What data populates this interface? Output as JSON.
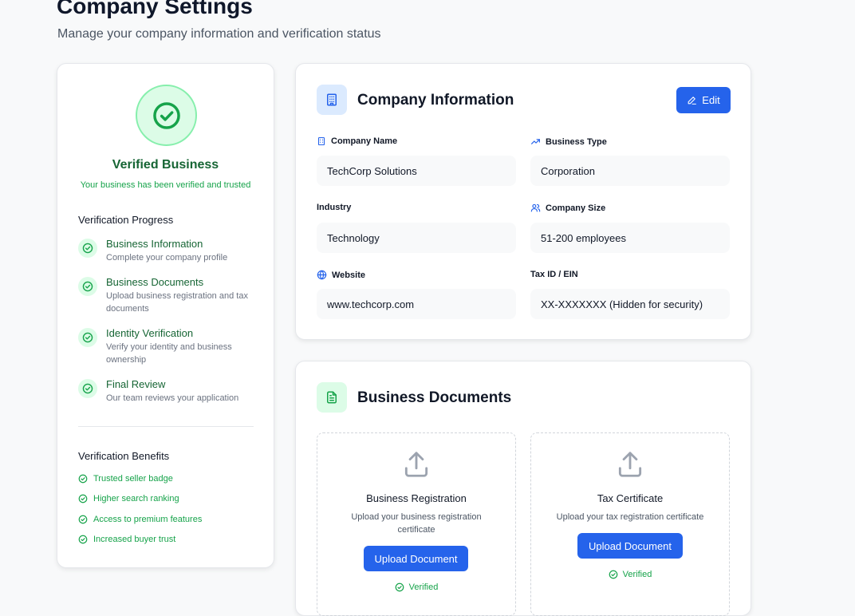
{
  "header": {
    "title": "Company Settings",
    "subtitle": "Manage your company information and verification status"
  },
  "verification": {
    "status_title": "Verified Business",
    "status_subtitle": "Your business has been verified and trusted",
    "progress_heading": "Verification Progress",
    "steps": [
      {
        "title": "Business Information",
        "description": "Complete your company profile"
      },
      {
        "title": "Business Documents",
        "description": "Upload business registration and tax documents"
      },
      {
        "title": "Identity Verification",
        "description": "Verify your identity and business ownership"
      },
      {
        "title": "Final Review",
        "description": "Our team reviews your application"
      }
    ],
    "benefits_heading": "Verification Benefits",
    "benefits": [
      "Trusted seller badge",
      "Higher search ranking",
      "Access to premium features",
      "Increased buyer trust"
    ]
  },
  "company_info": {
    "title": "Company Information",
    "edit_label": "Edit",
    "fields": {
      "company_name": {
        "label": "Company Name",
        "value": "TechCorp Solutions",
        "icon": "building-icon"
      },
      "business_type": {
        "label": "Business Type",
        "value": "Corporation",
        "icon": "trending-up-icon"
      },
      "industry": {
        "label": "Industry",
        "value": "Technology"
      },
      "company_size": {
        "label": "Company Size",
        "value": "51-200 employees",
        "icon": "users-icon"
      },
      "website": {
        "label": "Website",
        "value": "www.techcorp.com",
        "icon": "globe-icon"
      },
      "tax_id": {
        "label": "Tax ID / EIN",
        "value": "XX-XXXXXXX (Hidden for security)"
      }
    }
  },
  "documents": {
    "title": "Business Documents",
    "items": [
      {
        "title": "Business Registration",
        "description": "Upload your business registration certificate",
        "button": "Upload Document",
        "status": "Verified"
      },
      {
        "title": "Tax Certificate",
        "description": "Upload your tax registration certificate",
        "button": "Upload Document",
        "status": "Verified"
      }
    ]
  },
  "colors": {
    "primary": "#2563eb",
    "success": "#16a34a",
    "success_dark": "#166534",
    "success_bg": "#dcfce7"
  }
}
